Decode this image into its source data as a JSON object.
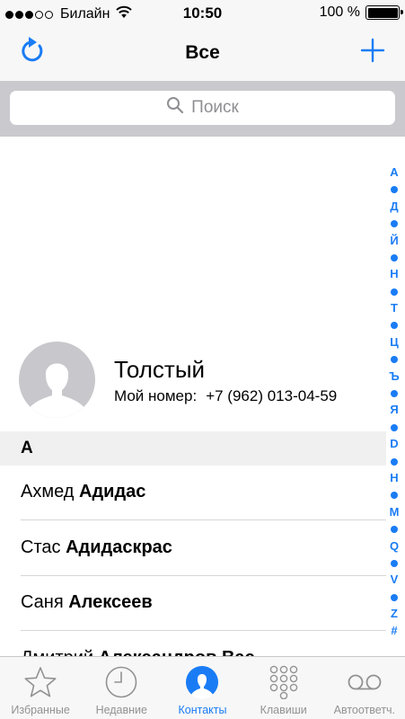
{
  "status_bar": {
    "carrier": "Билайн",
    "time": "10:50",
    "battery": "100 %",
    "signal_bars_filled": 3,
    "signal_bars_total": 5
  },
  "nav": {
    "title": "Все",
    "left_icon": "refresh-icon",
    "right_icon": "plus-icon"
  },
  "search": {
    "placeholder": "Поиск"
  },
  "my_card": {
    "name": "Толстый",
    "number_label": "Мой номер:",
    "number": "+7 (962) 013-04-59"
  },
  "section_header": "А",
  "contacts": [
    {
      "first": "Ахмед",
      "last": "Адидас"
    },
    {
      "first": "Стас",
      "last": "Адидаскрас"
    },
    {
      "first": "Саня",
      "last": "Алексеев"
    },
    {
      "first": "Дмитрий",
      "last": "Александров Вас..."
    }
  ],
  "index": [
    "А",
    "•",
    "Д",
    "•",
    "Й",
    "•",
    "Н",
    "•",
    "Т",
    "•",
    "Ц",
    "•",
    "Ъ",
    "•",
    "Я",
    "•",
    "D",
    "•",
    "H",
    "•",
    "M",
    "•",
    "Q",
    "•",
    "V",
    "•",
    "Z",
    "#"
  ],
  "tabs": [
    {
      "label": "Избранные",
      "icon": "star-icon",
      "active": false
    },
    {
      "label": "Недавние",
      "icon": "clock-icon",
      "active": false
    },
    {
      "label": "Контакты",
      "icon": "contacts-icon",
      "active": true
    },
    {
      "label": "Клавиши",
      "icon": "keypad-icon",
      "active": false
    },
    {
      "label": "Автоответч.",
      "icon": "voicemail-icon",
      "active": false
    }
  ],
  "colors": {
    "accent": "#1a7cf5",
    "inactive": "#929292",
    "bar_background": "#f7f7f7",
    "search_background": "#c9c9ce"
  }
}
